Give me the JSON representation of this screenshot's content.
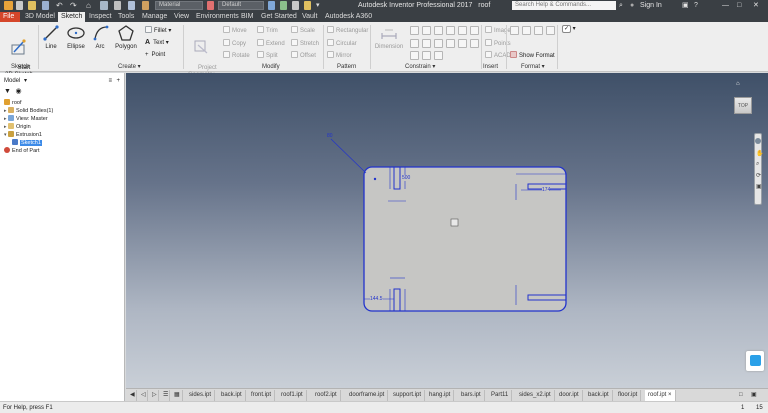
{
  "app": {
    "title": "Autodesk Inventor Professional 2017",
    "document": "roof",
    "search_placeholder": "Search Help & Commands...",
    "user": "Sign In",
    "quick_access": {
      "material": "Material",
      "appearance": "Default"
    }
  },
  "tabs": [
    "File",
    "3D Model",
    "Sketch",
    "Inspect",
    "Tools",
    "Manage",
    "View",
    "Environments",
    "BIM",
    "Get Started",
    "Vault",
    "Autodesk A360"
  ],
  "active_tab": "Sketch",
  "ribbon": {
    "sketch": {
      "start_label": "Start\n2D Sketch",
      "panel": "Sketch"
    },
    "create": {
      "line": "Line",
      "ellipse": "Ellipse",
      "arc": "Arc",
      "polygon": "Polygon",
      "fillet": "Fillet",
      "text": "Text",
      "point": "Point",
      "panel": "Create"
    },
    "project_geometry": "Project\nGeometry",
    "modify": {
      "move": "Move",
      "copy": "Copy",
      "rotate": "Rotate",
      "trim": "Trim",
      "extend": "Extend",
      "split": "Split",
      "scale": "Scale",
      "stretch": "Stretch",
      "offset": "Offset",
      "panel": "Modify"
    },
    "pattern": {
      "rectangular": "Rectangular",
      "circular": "Circular",
      "mirror": "Mirror",
      "panel": "Pattern"
    },
    "constrain": {
      "dimension": "Dimension",
      "panel": "Constrain"
    },
    "insert": {
      "image": "Image",
      "points": "Points",
      "acad": "ACAD",
      "panel": "Insert"
    },
    "format": {
      "show_format": "Show Format",
      "panel": "Format"
    }
  },
  "browser": {
    "header": "Model",
    "items": [
      {
        "label": "roof",
        "icon": "part-icon"
      },
      {
        "label": "Solid Bodies(1)",
        "icon": "solid-bodies-icon"
      },
      {
        "label": "View: Master",
        "icon": "view-icon"
      },
      {
        "label": "Origin",
        "icon": "origin-icon"
      },
      {
        "label": "Extrusion1",
        "icon": "extrusion-icon"
      },
      {
        "label": "Sketch1",
        "icon": "sketch-icon"
      },
      {
        "label": "End of Part",
        "icon": "end-of-part-icon"
      }
    ]
  },
  "viewport": {
    "viewcube_label": "TOP",
    "dimensions": {
      "d1": "80",
      "d2": "500",
      "d3": "174",
      "d4": "144.5"
    }
  },
  "doc_tabs": [
    "sides.ipt",
    "back.ipt",
    "front.ipt",
    "roof1.ipt",
    "roof2.ipt",
    "doorframe.ipt",
    "support.ipt",
    "hang.ipt",
    "bars.ipt",
    "Part11",
    "sides_x2.ipt",
    "door.ipt",
    "back.ipt",
    "floor.ipt",
    "roof.ipt"
  ],
  "active_doc": "roof.ipt",
  "status": {
    "help": "For Help, press F1",
    "n1": "1",
    "n2": "15"
  },
  "colors": {
    "file_tab": "#d5462a",
    "sketch_blue": "#2233cc",
    "accent": "#3d8be8"
  }
}
